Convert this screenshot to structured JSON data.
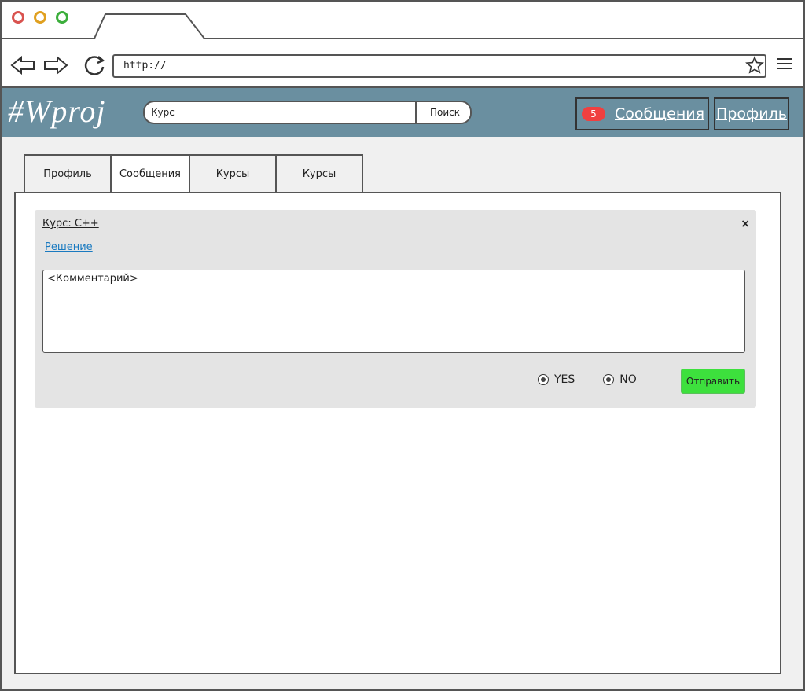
{
  "browser": {
    "url": "http://",
    "icons": [
      "back-arrow-icon",
      "forward-arrow-icon",
      "reload-icon",
      "star-icon",
      "hamburger-menu-icon"
    ]
  },
  "app": {
    "logo": "#Wproj",
    "search": {
      "value": "Курс",
      "button_label": "Поиск"
    },
    "messages": {
      "count": "5",
      "label": "Сообщения"
    },
    "profile_label": "Профиль",
    "colors": {
      "header": "#6a8fa0",
      "badge": "#f04040",
      "send": "#3de03d",
      "link": "#1a7ac0"
    }
  },
  "tabs": [
    "Профиль",
    "Сообщения",
    "Курсы",
    "Курсы"
  ],
  "card": {
    "title": "Курс: C++",
    "close_label": "×",
    "solution_link": "Решение",
    "comment_placeholder": "<Комментарий>",
    "options": [
      "YES",
      "NO"
    ],
    "submit_label": "Отправить"
  }
}
